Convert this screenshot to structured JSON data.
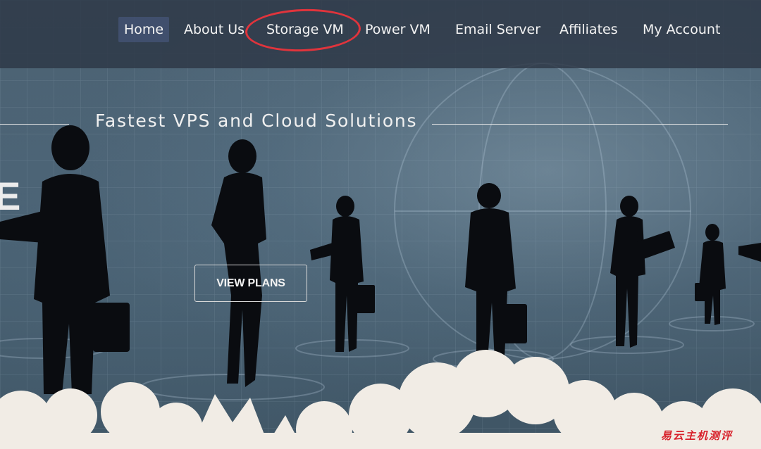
{
  "nav": {
    "items": [
      {
        "label": "Home",
        "active": true
      },
      {
        "label": "About Us"
      },
      {
        "label": "Storage VM",
        "highlighted": true
      },
      {
        "label": "Power VM"
      },
      {
        "label": "Email Server"
      },
      {
        "label": "Affiliates"
      },
      {
        "label": "My Account"
      }
    ]
  },
  "hero": {
    "tagline": "Fastest VPS and Cloud Solutions",
    "partial_heading": "E",
    "cta_label": "VIEW PLANS"
  },
  "annotation": {
    "color": "#e0343c"
  },
  "watermark": {
    "text": "易云主机测评"
  },
  "colors": {
    "nav_bg": "#2d3746",
    "cloud": "#f1ece5",
    "silhouette": "#0a0c10"
  }
}
